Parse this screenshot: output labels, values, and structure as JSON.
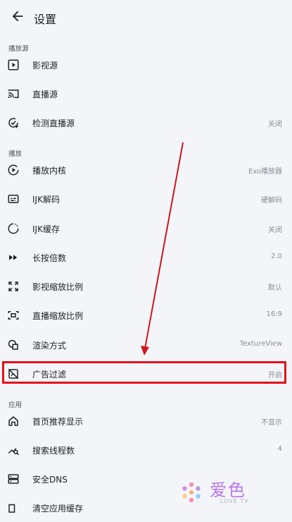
{
  "appbar": {
    "title": "设置"
  },
  "sections": {
    "source": "播放源",
    "play": "播放",
    "app": "应用"
  },
  "rows": {
    "vod": {
      "label": "影视源",
      "value": ""
    },
    "live": {
      "label": "直播源",
      "value": ""
    },
    "check_live": {
      "label": "检测直播源",
      "value": "关闭"
    },
    "player": {
      "label": "播放内核",
      "value": "Exo播放器"
    },
    "ijk_decode": {
      "label": "IJK解码",
      "value": "硬解码"
    },
    "ijk_cache": {
      "label": "IJK缓存",
      "value": "关闭"
    },
    "long_press_speed": {
      "label": "长按倍数",
      "value": "2.0"
    },
    "vod_scale": {
      "label": "影视缩放比例",
      "value": "默认"
    },
    "live_scale": {
      "label": "直播缩放比例",
      "value": "16:9"
    },
    "render": {
      "label": "渲染方式",
      "value": "TextureView"
    },
    "ad_filter": {
      "label": "广告过滤",
      "value": "开启"
    },
    "home_recommend": {
      "label": "首页推荐显示",
      "value": "不显示"
    },
    "search_threads": {
      "label": "搜索线程数",
      "value": "4"
    },
    "secure_dns": {
      "label": "安全DNS",
      "value": ""
    },
    "clear_cache": {
      "label": "清空应用缓存",
      "value": ""
    }
  },
  "watermark": {
    "text": "爱色",
    "sub": "LOVE TV"
  },
  "colors": {
    "background": "#f3f5f9",
    "highlight": "#e3101a",
    "arrow": "#d0141c",
    "watermark": "#b878f0"
  }
}
